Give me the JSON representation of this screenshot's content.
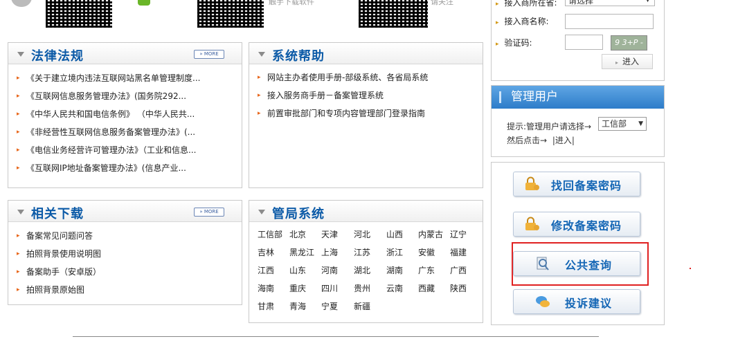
{
  "top": {
    "qr_captions": [
      "触手下载软件",
      "请关注"
    ]
  },
  "panels": {
    "laws": {
      "title": "法律法规",
      "more": "» MORE",
      "items": [
        "《关于建立境内违法互联网站黑名单管理制度...",
        "《互联网信息服务管理办法》(国务院292...",
        "《中华人民共和国电信条例》 （中华人民共...",
        "《非经营性互联网信息服务备案管理办法》(...",
        "《电信业务经营许可管理办法》（工业和信息...",
        "《互联网IP地址备案管理办法》(信息产业..."
      ]
    },
    "help": {
      "title": "系统帮助",
      "items": [
        "网站主办者使用手册-部级系统、各省局系统",
        "接入服务商手册－备案管理系统",
        "前置审批部门和专项内容管理部门登录指南"
      ]
    },
    "downloads": {
      "title": "相关下载",
      "more": "» MORE",
      "items": [
        "备案常见问题问答",
        "拍照背景使用说明图",
        "备案助手（安卓版）",
        "拍照背景原始图"
      ]
    },
    "bureau": {
      "title": "管局系统",
      "regions": [
        [
          "工信部",
          "北京",
          "天津",
          "河北",
          "山西",
          "内蒙古",
          "辽宁"
        ],
        [
          "吉林",
          "黑龙江",
          "上海",
          "江苏",
          "浙江",
          "安徽",
          "福建"
        ],
        [
          "江西",
          "山东",
          "河南",
          "湖北",
          "湖南",
          "广东",
          "广西"
        ],
        [
          "海南",
          "重庆",
          "四川",
          "贵州",
          "云南",
          "西藏",
          "陕西"
        ],
        [
          "甘肃",
          "青海",
          "宁夏",
          "新疆"
        ]
      ]
    }
  },
  "login": {
    "access_bureau_label": "接入商所在省:",
    "access_bureau_value": "请选择",
    "name_label": "接入商名称:",
    "captcha_label": "验证码:",
    "captcha_text": "9 3+P -",
    "enter_label": "进入"
  },
  "admin": {
    "title": "管理用户",
    "hint": "提示:管理用户请选择→",
    "select_value": "工信部",
    "then_click": "然后点击→",
    "enter_link": "|进入|"
  },
  "actions": {
    "retrieve": "找回备案密码",
    "modify": "修改备案密码",
    "query": "公共查询",
    "complaint": "投诉建议"
  },
  "colors": {
    "accent": "#0b5aa7",
    "bullet": "#e8661a",
    "highlight": "#e02020"
  }
}
